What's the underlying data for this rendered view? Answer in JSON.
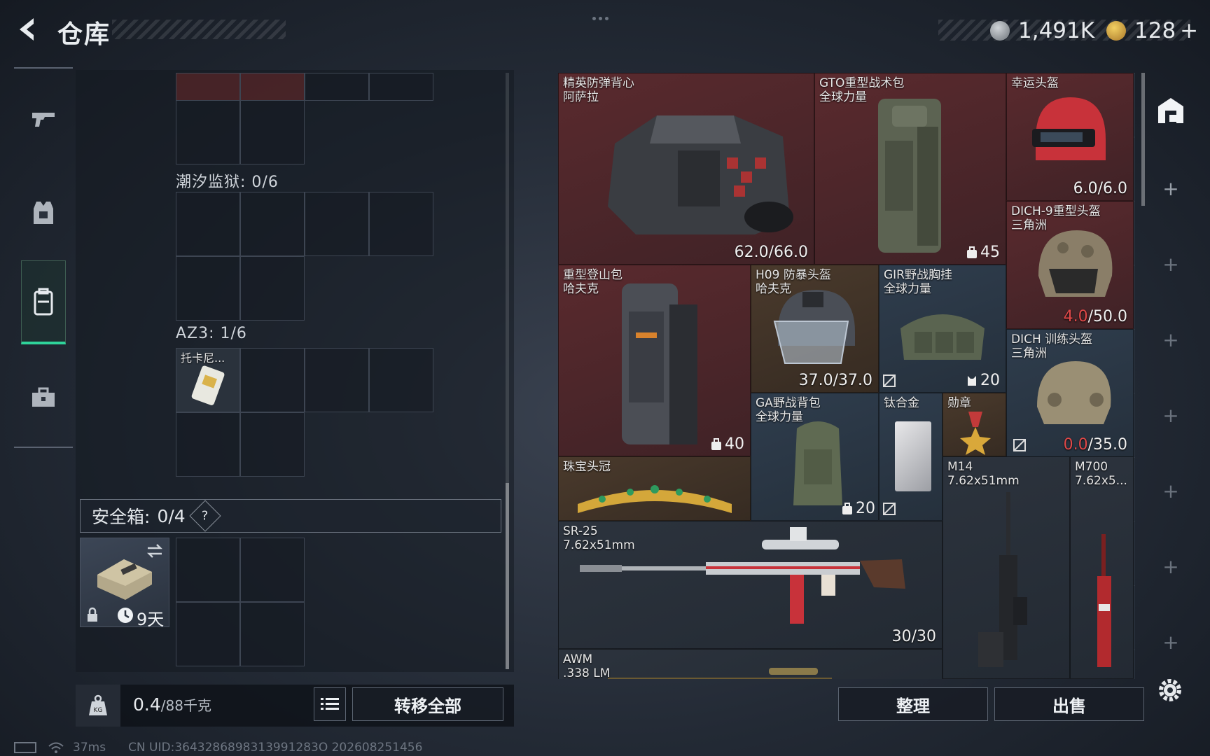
{
  "header": {
    "title": "仓库",
    "currency_silver": "1,491K",
    "currency_gold": "128",
    "currency_gold_suffix": "+"
  },
  "left_nav": [
    {
      "icon": "gun-icon"
    },
    {
      "icon": "vest-icon"
    },
    {
      "icon": "backpack-icon",
      "selected": true
    },
    {
      "icon": "briefcase-icon"
    }
  ],
  "containers": {
    "tide_prison_label": "潮汐监狱: 0/6",
    "az3_label": "AZ3: 1/6",
    "az3_item_name": "托卡尼...",
    "safe_box_label": "安全箱:",
    "safe_box_count": "0/4",
    "safe_box_help": "?",
    "safe_case_timer": "9天"
  },
  "bottom_left": {
    "weight": "0.4",
    "weight_max": "/88千克",
    "transfer_all": "转移全部"
  },
  "items": [
    {
      "name": "精英防弹背心\n阿萨拉",
      "value": "62.0/66.0"
    },
    {
      "name": "GTO重型战术包\n全球力量",
      "capacity": "45"
    },
    {
      "name": "幸运头盔",
      "value": "6.0/6.0"
    },
    {
      "name": "DICH-9重型头盔\n三角洲",
      "value_low": "4.0",
      "value_rest": "/50.0"
    },
    {
      "name": "重型登山包\n哈夫克",
      "capacity": "40"
    },
    {
      "name": "H09 防暴头盔\n哈夫克",
      "value": "37.0/37.0"
    },
    {
      "name": "GIR野战胸挂\n全球力量",
      "capacity": "20"
    },
    {
      "name": "DICH 训练头盔\n三角洲",
      "value_low": "0.0",
      "value_rest": "/35.0"
    },
    {
      "name": "GA野战背包\n全球力量",
      "capacity": "20"
    },
    {
      "name": "钛合金"
    },
    {
      "name": "勋章"
    },
    {
      "name": "珠宝头冠"
    },
    {
      "name": "M14\n7.62x51mm"
    },
    {
      "name": "M700\n7.62x5..."
    },
    {
      "name": "SR-25\n7.62x51mm",
      "ammo": "30/30"
    },
    {
      "name": "AWM\n.338 LM"
    }
  ],
  "bottom_right": {
    "sort": "整理",
    "sell": "出售"
  },
  "status_bar": {
    "ping": "37ms",
    "uid": "CN UID:3643286898313991283O 202608251456"
  }
}
